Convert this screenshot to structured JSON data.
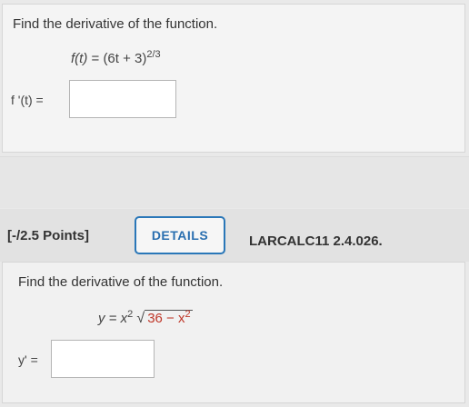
{
  "question1": {
    "prompt": "Find the derivative of the function.",
    "function_lhs": "f(t)",
    "function_rhs_base": "(6t + 3)",
    "function_exponent": "2/3",
    "answer_label": "f '(t) =",
    "answer_value": ""
  },
  "question2": {
    "points": "[-/2.5 Points]",
    "details_label": "DETAILS",
    "problem_code": "LARCALC11 2.4.026.",
    "prompt": "Find the derivative of the function.",
    "function_lhs": "y =",
    "function_term": "x",
    "function_term_exp": "2",
    "radicand_text": "36 − x",
    "radicand_exp": "2",
    "answer_label": "y' =",
    "answer_value": ""
  },
  "colors": {
    "accent": "#2a77b8",
    "radicand": "#c0392b"
  }
}
